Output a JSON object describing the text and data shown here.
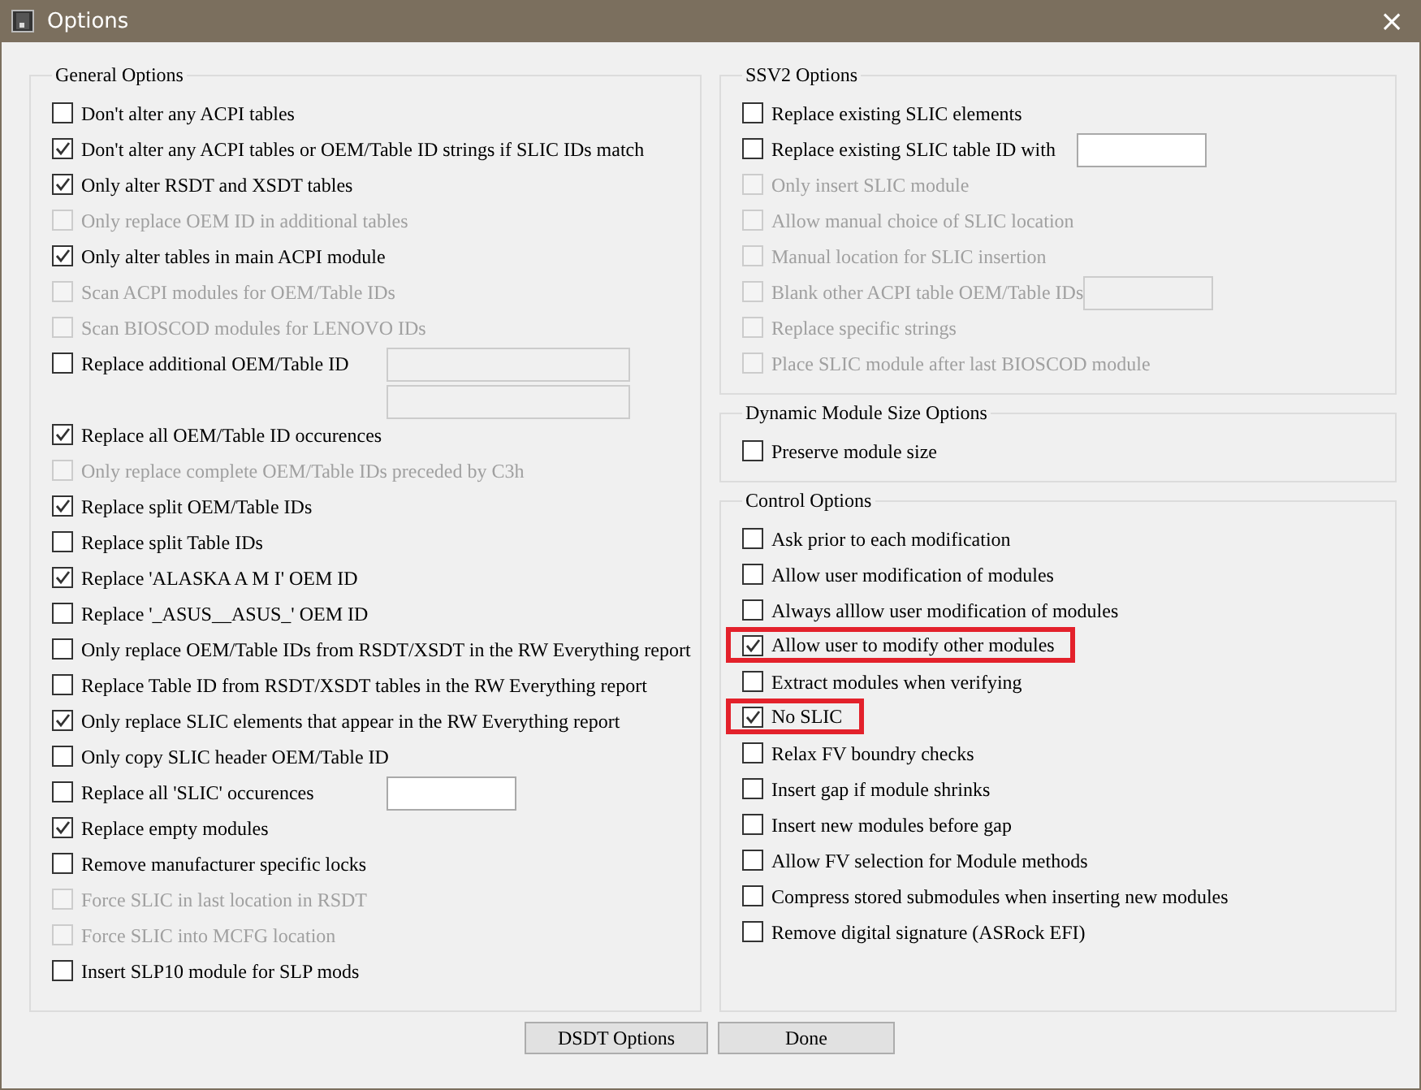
{
  "window": {
    "title": "Options",
    "close": "×"
  },
  "columns": [
    {
      "groups": [
        {
          "title": "General Options",
          "items": [
            {
              "label": "Don't alter any ACPI tables",
              "checked": false,
              "disabled": false
            },
            {
              "label": "Don't alter any ACPI tables or OEM/Table ID strings if SLIC IDs match",
              "checked": true,
              "disabled": false
            },
            {
              "label": "Only alter RSDT and XSDT tables",
              "checked": true,
              "disabled": false
            },
            {
              "label": "Only replace OEM ID in additional tables",
              "checked": false,
              "disabled": true
            },
            {
              "label": "Only alter tables in main ACPI module",
              "checked": true,
              "disabled": false
            },
            {
              "label": "Scan ACPI modules for OEM/Table IDs",
              "checked": false,
              "disabled": true
            },
            {
              "label": "Scan BIOSCOD modules for LENOVO IDs",
              "checked": false,
              "disabled": true
            },
            {
              "label": "Replace additional OEM/Table ID",
              "checked": false,
              "disabled": false,
              "fields": [
                {
                  "disabled": true
                },
                {
                  "disabled": true
                }
              ]
            },
            {
              "label": "Replace all OEM/Table ID occurences",
              "checked": true,
              "disabled": false
            },
            {
              "label": "Only replace complete OEM/Table IDs preceded by C3h",
              "checked": false,
              "disabled": true
            },
            {
              "label": "Replace split OEM/Table IDs",
              "checked": true,
              "disabled": false
            },
            {
              "label": "Replace split Table IDs",
              "checked": false,
              "disabled": false
            },
            {
              "label": "Replace 'ALASKA A M I' OEM ID",
              "checked": true,
              "disabled": false
            },
            {
              "label": "Replace '_ASUS__ASUS_' OEM ID",
              "checked": false,
              "disabled": false
            },
            {
              "label": "Only replace OEM/Table IDs from RSDT/XSDT in the RW Everything report",
              "checked": false,
              "disabled": false
            },
            {
              "label": "Replace Table ID from RSDT/XSDT tables in the RW Everything report",
              "checked": false,
              "disabled": false
            },
            {
              "label": "Only replace SLIC elements that appear in the RW Everything report",
              "checked": true,
              "disabled": false
            },
            {
              "label": "Only copy SLIC header OEM/Table ID",
              "checked": false,
              "disabled": false
            },
            {
              "label": "Replace all 'SLIC' occurences",
              "checked": false,
              "disabled": false,
              "fields": [
                {
                  "disabled": false
                }
              ]
            },
            {
              "label": "Replace empty modules",
              "checked": true,
              "disabled": false
            },
            {
              "label": "Remove manufacturer specific locks",
              "checked": false,
              "disabled": false
            },
            {
              "label": "Force SLIC in last location in RSDT",
              "checked": false,
              "disabled": true
            },
            {
              "label": "Force SLIC into MCFG location",
              "checked": false,
              "disabled": true
            },
            {
              "label": "Insert SLP10 module for SLP mods",
              "checked": false,
              "disabled": false
            }
          ]
        }
      ]
    },
    {
      "groups": [
        {
          "title": "SSV2 Options",
          "items": [
            {
              "label": "Replace existing SLIC elements",
              "checked": false,
              "disabled": false
            },
            {
              "label": "Replace existing SLIC table ID with",
              "checked": false,
              "disabled": false,
              "fields": [
                {
                  "disabled": false
                }
              ]
            },
            {
              "label": "Only insert SLIC module",
              "checked": false,
              "disabled": true
            },
            {
              "label": "Allow manual choice of SLIC location",
              "checked": false,
              "disabled": true
            },
            {
              "label": "Manual location for SLIC insertion",
              "checked": false,
              "disabled": true
            },
            {
              "label": "Blank other ACPI table OEM/Table IDs",
              "checked": false,
              "disabled": true,
              "fields": [
                {
                  "disabled": true
                }
              ]
            },
            {
              "label": "Replace specific strings",
              "checked": false,
              "disabled": true
            },
            {
              "label": "Place SLIC module after last BIOSCOD module",
              "checked": false,
              "disabled": true
            }
          ]
        },
        {
          "title": "Dynamic Module Size Options",
          "items": [
            {
              "label": "Preserve module size",
              "checked": false,
              "disabled": false
            }
          ]
        },
        {
          "title": "Control Options",
          "items": [
            {
              "label": "Ask prior to each modification",
              "checked": false,
              "disabled": false
            },
            {
              "label": "Allow user modification of modules",
              "checked": false,
              "disabled": false
            },
            {
              "label": "Always alllow user modification of modules",
              "checked": false,
              "disabled": false
            },
            {
              "label": "Allow user to modify other modules",
              "checked": true,
              "disabled": false,
              "highlighted": true
            },
            {
              "label": "Extract modules when verifying",
              "checked": false,
              "disabled": false
            },
            {
              "label": "No SLIC",
              "checked": true,
              "disabled": false,
              "highlighted": true
            },
            {
              "label": "Relax FV boundry checks",
              "checked": false,
              "disabled": false
            },
            {
              "label": "Insert gap if module shrinks",
              "checked": false,
              "disabled": false
            },
            {
              "label": "Insert new modules before gap",
              "checked": false,
              "disabled": false
            },
            {
              "label": "Allow FV selection for Module methods",
              "checked": false,
              "disabled": false
            },
            {
              "label": "Compress stored submodules when inserting new modules",
              "checked": false,
              "disabled": false
            },
            {
              "label": "Remove digital signature (ASRock EFI)",
              "checked": false,
              "disabled": false
            }
          ]
        }
      ]
    }
  ],
  "buttons": [
    "DSDT Options",
    "Done"
  ]
}
